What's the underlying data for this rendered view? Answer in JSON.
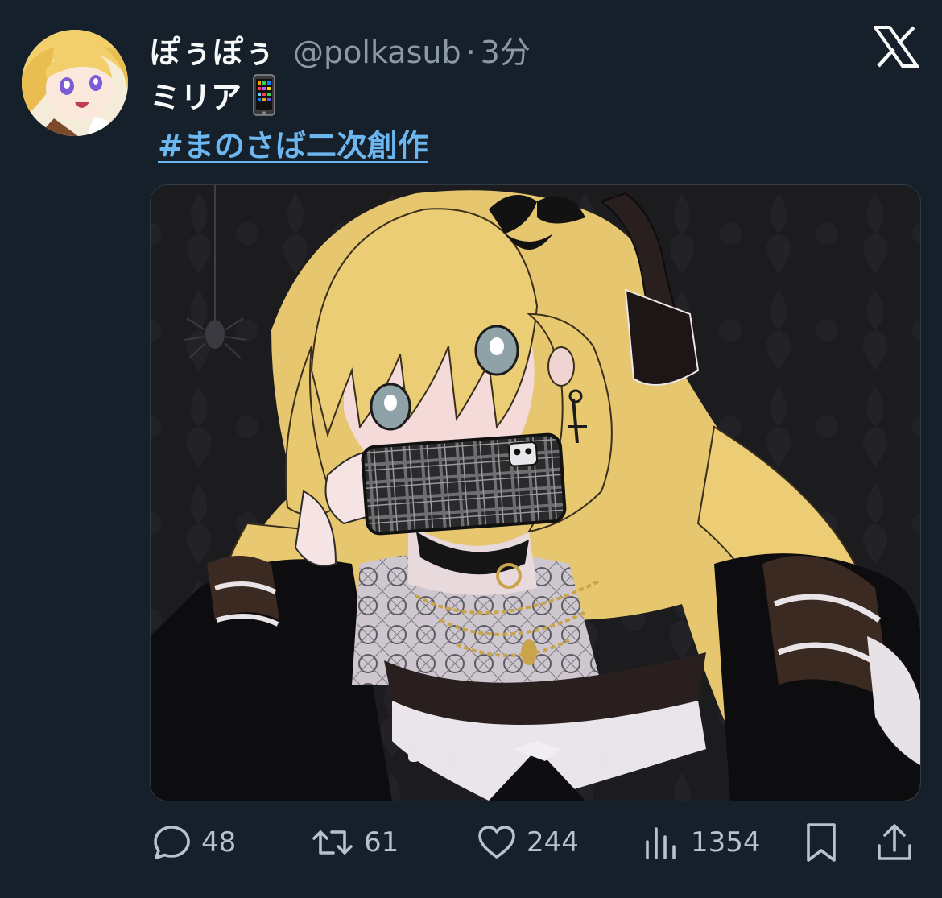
{
  "tweet": {
    "display_name": "ぽぅぽぅ",
    "handle": "@polkasub",
    "separator": "·",
    "time": "3分",
    "text": "ミリア",
    "emoji": "mobile-phone-emoji",
    "hashtag": "#まのさば二次創作"
  },
  "actions": {
    "replies": "48",
    "retweets": "61",
    "likes": "244",
    "views": "1354"
  },
  "icons": {
    "reply": "reply-icon",
    "retweet": "retweet-icon",
    "like": "heart-icon",
    "views": "views-icon",
    "bookmark": "bookmark-icon",
    "share": "share-icon",
    "platform": "x-logo-icon"
  },
  "colors": {
    "background": "#15202b",
    "text": "#f7f9f9",
    "secondary": "#8b98a5",
    "link": "#6cb7f0",
    "icon": "#b8c2cc"
  }
}
